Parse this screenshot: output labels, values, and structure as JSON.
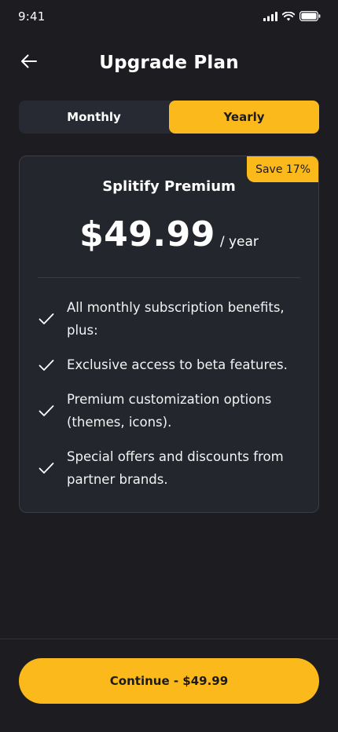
{
  "status_bar": {
    "time": "9:41",
    "icons": [
      "cellular-signal-icon",
      "wifi-icon",
      "battery-icon"
    ]
  },
  "header": {
    "title": "Upgrade Plan",
    "back_icon": "arrow-left-icon"
  },
  "billing_toggle": {
    "options": [
      {
        "label": "Monthly",
        "selected": false
      },
      {
        "label": "Yearly",
        "selected": true
      }
    ]
  },
  "plan": {
    "badge": "Save 17%",
    "name": "Splitify Premium",
    "price": "$49.99",
    "period": "/ year",
    "features": [
      "All monthly subscription benefits, plus:",
      "Exclusive access to beta features.",
      "Premium customization options (themes, icons).",
      "Special offers and discounts from partner brands."
    ],
    "feature_icon": "checkmark-icon"
  },
  "cta": {
    "label": "Continue - $49.99"
  },
  "colors": {
    "background": "#1c1c21",
    "card": "#24262e",
    "accent": "#fbb91c",
    "text": "#ffffff"
  }
}
